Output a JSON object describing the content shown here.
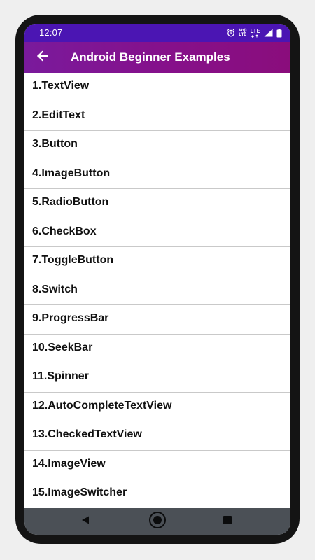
{
  "status_bar": {
    "time": "12:07",
    "volte_top": "Vo))",
    "volte_bottom": "LTE",
    "lte_label": "LTE",
    "icons": [
      "alarm-icon",
      "volte-icon",
      "lte-icon",
      "signal-icon",
      "battery-icon"
    ]
  },
  "app_bar": {
    "title": "Android Beginner Examples",
    "back_icon": "arrow-back-icon",
    "background_colors": [
      "#7a1a9c",
      "#8a0d7c"
    ]
  },
  "list": {
    "items": [
      {
        "label": "1.TextView"
      },
      {
        "label": "2.EditText"
      },
      {
        "label": "3.Button"
      },
      {
        "label": "4.ImageButton"
      },
      {
        "label": "5.RadioButton"
      },
      {
        "label": "6.CheckBox"
      },
      {
        "label": "7.ToggleButton"
      },
      {
        "label": "8.Switch"
      },
      {
        "label": "9.ProgressBar"
      },
      {
        "label": "10.SeekBar"
      },
      {
        "label": "11.Spinner"
      },
      {
        "label": "12.AutoCompleteTextView"
      },
      {
        "label": "13.CheckedTextView"
      },
      {
        "label": "14.ImageView"
      },
      {
        "label": "15.ImageSwitcher"
      }
    ]
  },
  "nav_bar": {
    "icons": [
      "nav-back-icon",
      "nav-home-icon",
      "nav-recents-icon"
    ]
  },
  "colors": {
    "status_bar": "#4b15b3",
    "nav_bar": "#4b5056",
    "frame": "#141414",
    "page_background": "#efefef"
  }
}
